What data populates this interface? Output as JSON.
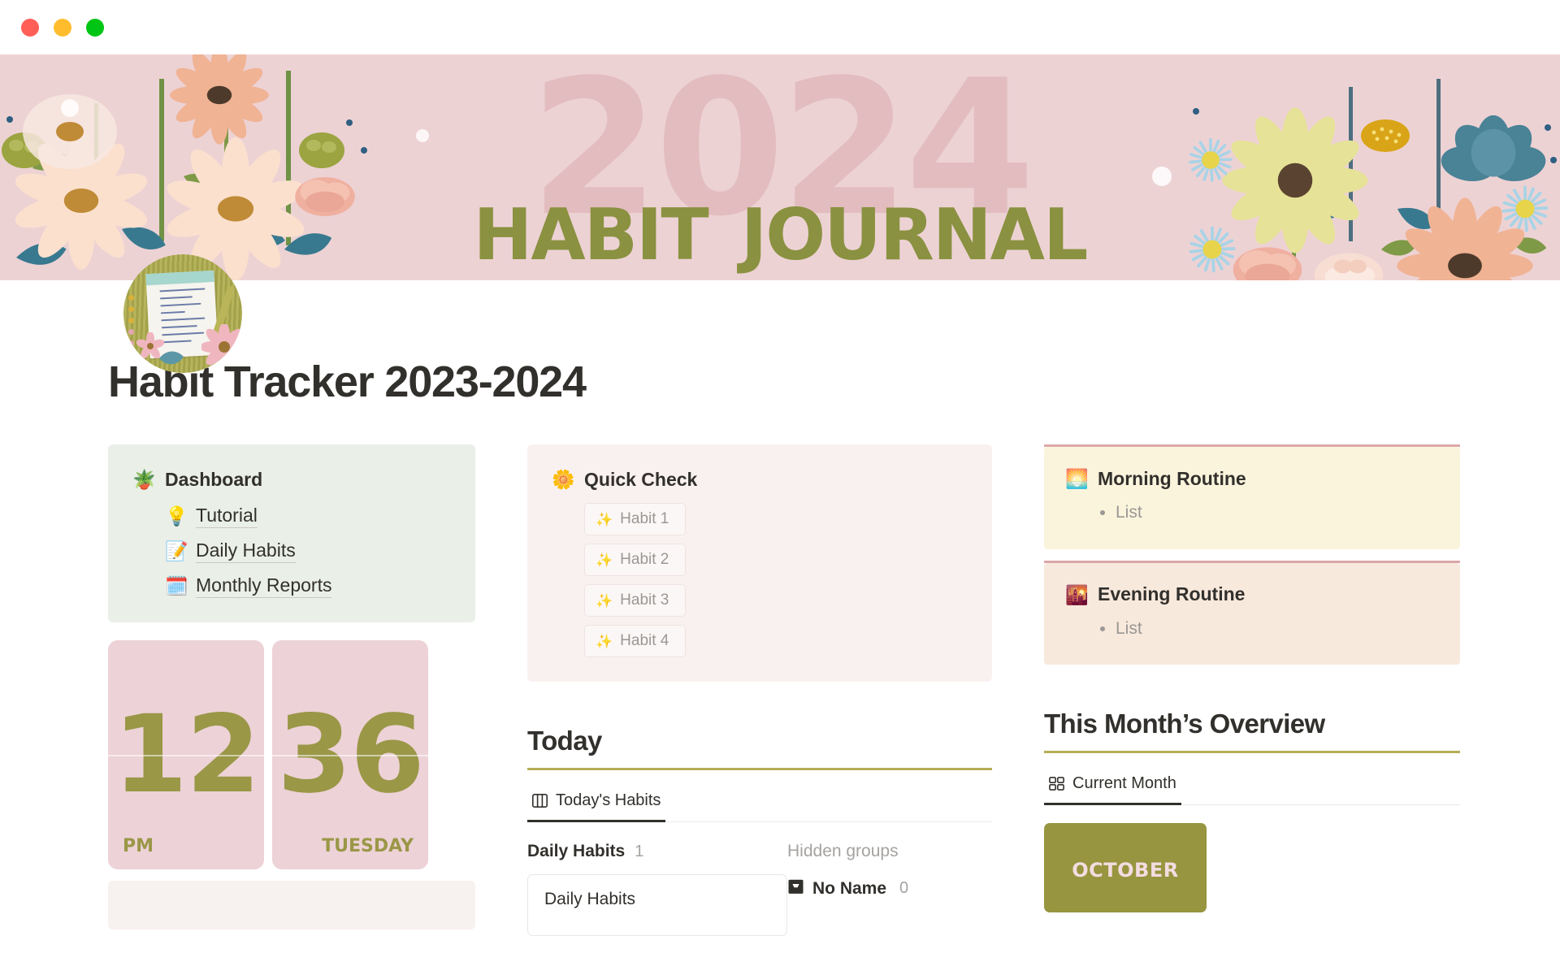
{
  "window": {
    "traffic_lights": [
      "close",
      "minimize",
      "maximize"
    ],
    "colors": {
      "close": "#ff5f57",
      "minimize": "#ffbd2e",
      "maximize": "#00c514"
    }
  },
  "banner": {
    "year": "2024",
    "title": "habit journal",
    "background_color": "#edd2d4",
    "title_color": "#8a9140",
    "year_color": "#e2bcbe"
  },
  "page": {
    "title": "Habit Tracker 2023-2024"
  },
  "dashboard": {
    "icon": "potted-plant",
    "title": "Dashboard",
    "links": [
      {
        "icon": "light-bulb",
        "label": "Tutorial"
      },
      {
        "icon": "note-page",
        "label": "Daily Habits"
      },
      {
        "icon": "calendar-page",
        "label": "Monthly Reports"
      }
    ]
  },
  "clock": {
    "hours": "12",
    "minutes": "36",
    "meridiem": "PM",
    "weekday": "TUESDAY",
    "face_color": "#edd2d7",
    "digit_color": "#9a9747"
  },
  "quick_check": {
    "icon": "flower",
    "title": "Quick Check",
    "items": [
      {
        "icon": "sparkles",
        "label": "Habit 1"
      },
      {
        "icon": "sparkles",
        "label": "Habit 2"
      },
      {
        "icon": "sparkles",
        "label": "Habit 3"
      },
      {
        "icon": "sparkles",
        "label": "Habit 4"
      }
    ]
  },
  "today": {
    "heading": "Today",
    "accent_color": "#b5ae56",
    "tab": {
      "icon": "board-view-icon",
      "label": "Today's Habits"
    },
    "group": {
      "name": "Daily Habits",
      "count": "1",
      "cards": [
        {
          "title": "Daily Habits"
        }
      ]
    },
    "hidden_groups": {
      "label": "Hidden groups",
      "items": [
        {
          "icon": "inbox-icon",
          "label": "No Name",
          "count": "0"
        }
      ]
    }
  },
  "routines": [
    {
      "icon": "sunrise",
      "title": "Morning Routine",
      "items": [
        "List"
      ],
      "background": "#fbf4dd",
      "rule_color": "#dda7a9"
    },
    {
      "icon": "sunset",
      "title": "Evening Routine",
      "items": [
        "List"
      ],
      "background": "#f8e9dd",
      "rule_color": "#dda7a9"
    }
  ],
  "month_overview": {
    "heading": "This Month’s Overview",
    "accent_color": "#b5ae56",
    "tab": {
      "icon": "grid-view-icon",
      "label": "Current Month"
    },
    "tile": {
      "label": "october",
      "background": "#97953f",
      "text_color": "#f3dde0"
    }
  }
}
